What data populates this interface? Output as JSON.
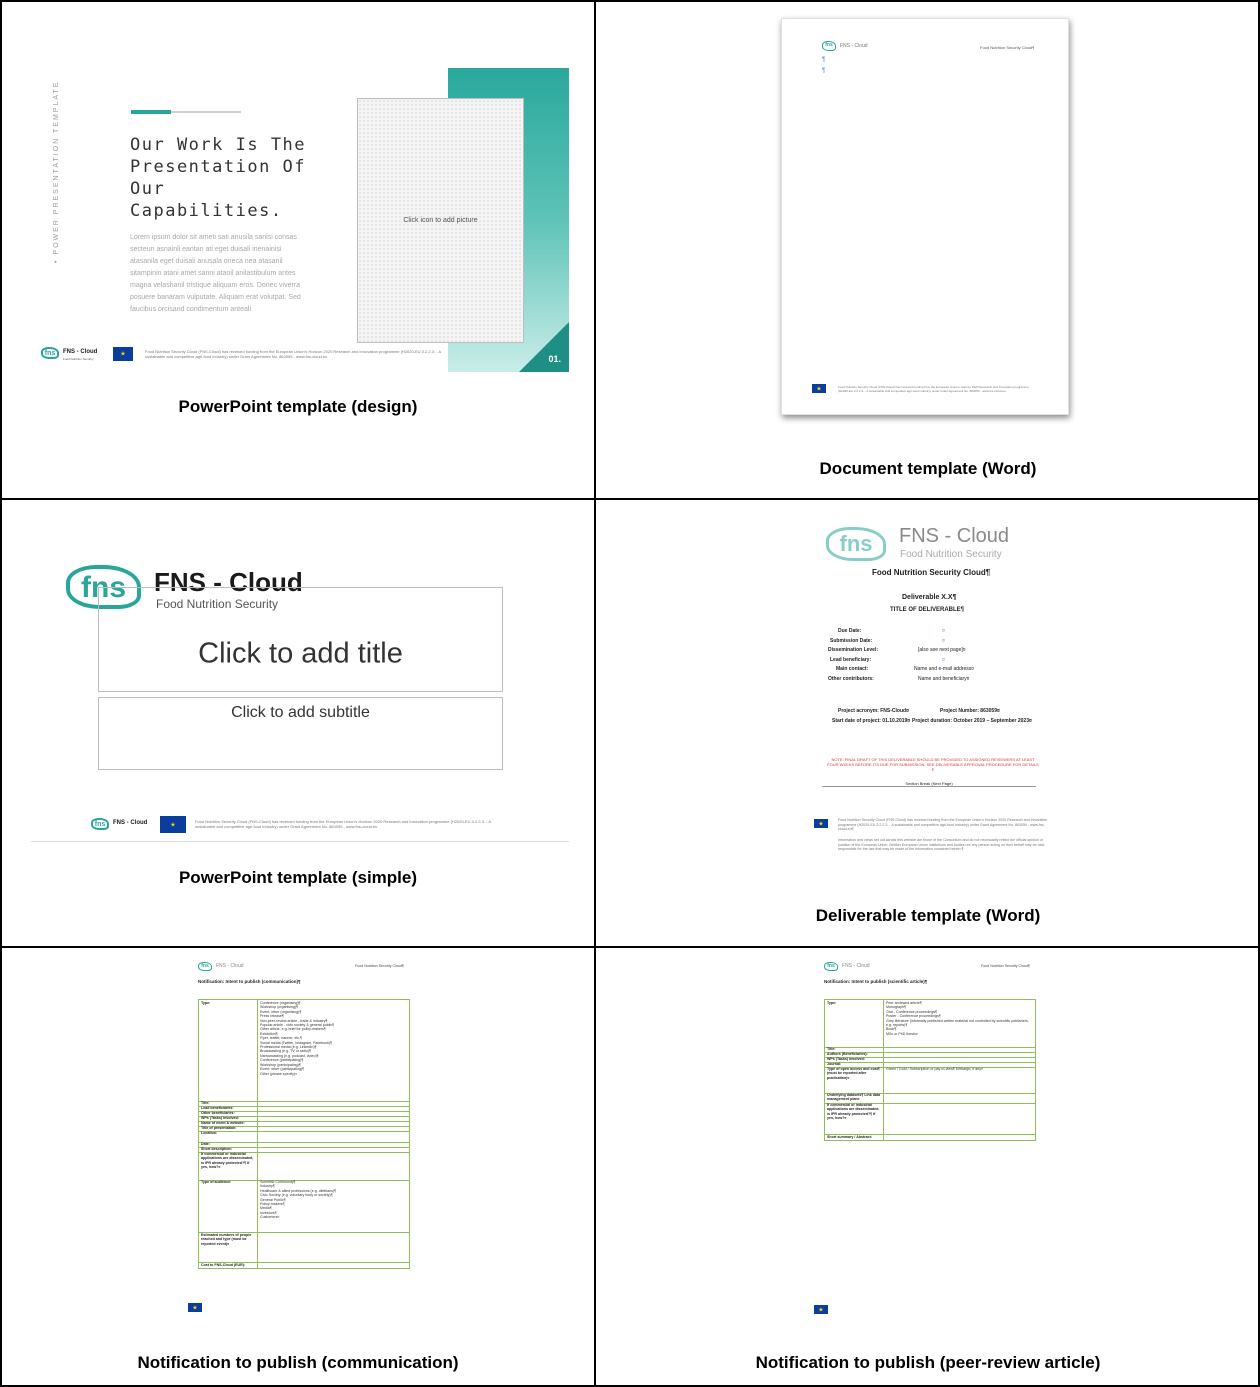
{
  "captions": {
    "ppt_design": "PowerPoint template (design)",
    "doc_word": "Document template (Word)",
    "ppt_simple": "PowerPoint template (simple)",
    "deliverable_word": "Deliverable template (Word)",
    "notif_comm": "Notification to publish (communication)",
    "notif_peer": "Notification to publish (peer-review article)"
  },
  "ppt_design": {
    "vertical_text": "• POWER PRESENTATION TEMPLATE",
    "heading_lines": [
      "Our Work Is The",
      "Presentation Of",
      "Our",
      "Capabilities."
    ],
    "body": "Lorem ipsum dolor sit ameti sati anusila sanisi consas secteun asnainli eantan ati eget duisali inenainisi atasanila eget duisali anusala oneca nea atasanil sitampinin atani amet sanni ataoil anilastibulum antes magna velashanil tristique aliquam eros. Donec viverra posuere banaram vulputate. Aliquam erat volutpat. Sed faucibus orcisand condimentum anteali",
    "picture_placeholder": "Click icon to add picture",
    "logo_name": "FNS - Cloud",
    "logo_tag": "Food Nutrition Security",
    "footer_text": "Food Nutrition Security Cloud (FNS-Cloud) has received funding from the European Union's Horizon 2020 Research and Innovation programme (H2020-EU.3.2.2.3. - A sustainable and competitive agri-food industry) under Grant Agreement No. 863059 - www.fns-cloud.eu",
    "slide_number": "01."
  },
  "doc_word": {
    "logo_name": "FNS - Cloud",
    "header_right": "Food Nutrition Security Cloud¶",
    "pilcrow": "¶",
    "footer_text": "Food Nutrition Security Cloud (FNS-Cloud) has received funding from the European Union's Horizon 2020 Research and Innovation programme (H2020-EU.3.2.2.3. - A sustainable and competitive agri-food industry) under Grant Agreement No. 863059 - www.fns-cloud.eu"
  },
  "ppt_simple": {
    "logo_name": "FNS - Cloud",
    "logo_tag": "Food Nutrition Security",
    "title_placeholder": "Click to add title",
    "subtitle_placeholder": "Click to add subtitle",
    "footer_text": "Food Nutrition Security Cloud (FNS-Cloud) has received funding from the European Union's Horizon 2020 Research and Innovation programme (H2020-EU.3.2.2.3. - A sustainable and competitive agri-food industry) under Grant Agreement No. 863059 - www.fns-cloud.eu"
  },
  "deliverable": {
    "logo_name": "FNS - Cloud",
    "logo_tag": "Food Nutrition Security",
    "org_name": "Food Nutrition Security Cloud¶",
    "deliverable": "Deliverable X.X¶",
    "title": "TITLE OF DELIVERABLE¶",
    "fields": [
      {
        "label": "Due Date:",
        "value": "¤"
      },
      {
        "label": "Submission Date:",
        "value": "¤"
      },
      {
        "label": "Dissemination Level:",
        "value": "[also see next page]¤"
      },
      {
        "label": "Lead beneficiary:",
        "value": "¤"
      },
      {
        "label": "Main contact:",
        "value": "Name and e-mail address¤"
      },
      {
        "label": "Other contributors:",
        "value": "Name and beneficiary¤"
      }
    ],
    "acronym": "Project acronym: FNS-Cloud¤",
    "project_number": "Project Number: 863059¤",
    "start_date": "Start date of project: 01.10.2019¤",
    "duration": "Project duration: October 2019 – September 2023¤",
    "note": "NOTE: FINAL DRAFT OF THIS DELIVERABLE SHOULD BE PROVIDED TO ASSIGNED REVIEWERS AT LEAST FOUR WEEKS BEFORE ITS DUE FOR SUBMISSION. SEE DELIVERABLE APPROVAL PROCEDURE FOR DETAILS ¶",
    "section_break": "Section Break (Next Page)",
    "footer1": "Food Nutrition Security Cloud (FNS-Cloud) has received funding from the European Union's Horizon 2020 Research and Innovation programme (H2020-EU.3.2.2.3. - A sustainable and competitive agri-food industry) under Grant Agreement No. 863059 - www.fns-cloud.eu¶",
    "footer2": "Information and views set out across this website are those of the Consortium and do not necessarily reflect the official opinion or position of the European Union. Neither European Union institutions and bodies nor any person acting on their behalf may be held responsible for the use that may be made of the information contained herein ¶"
  },
  "notif_comm": {
    "logo_name": "FNS - Cloud",
    "header_right": "Food Nutrition Security Cloud¶",
    "title": "Notification: Intent to publish (communication)¶",
    "type_label": "Type:",
    "type_values": [
      "Conference (organising)¶",
      "Workshop (organising)¶",
      "Event, other (organising)¶",
      "Press release¶",
      "Non-peer-review article - trade & industry¶",
      "Popular article - civic society & general public¶",
      "Other article, e.g. brief for policy-makers¶",
      "Exhibition¶",
      "Flyer, leaflet, banner, etc.¶",
      "Social media (Twitter, Instagram, Facebook)¶",
      "Professional media (e.g. LinkedIn)¶",
      "Broadcasting (e.g. TV or radio)¶",
      "Narrowcasting (e.g. podcast, video)¶",
      "Conference (participating)¶",
      "Workshop (participating)¶",
      "Event, other (participating)¶",
      "Other (please specify)¤"
    ],
    "rows": [
      "Title:",
      "Lead beneficiaries:",
      "Other beneficiaries:",
      "WPs (Tasks) involved:",
      "Name of event & website:",
      "Title of presentation:",
      "Location:",
      "Date:",
      "Short description:"
    ],
    "ipr_label": "If commercial or industrial applications are disseminated, is IPR already protected?¶ If yes, how?¤",
    "audience_label": "Type of audience:",
    "audience_values": [
      "Scientific Community¶",
      "Industry¶",
      "Healthcare & allied professions (e.g. dietitians)¶",
      "Civic Society (e.g. voluntary body or society)¶",
      "General Public¶",
      "Policy-makers¶",
      "Media¶",
      "Investors¶",
      "Customers¤"
    ],
    "estimated_label": "Estimated numbers of people reached and type (must be reported event)¤",
    "cost_label": "Cost to FNS-Cloud (EUR):"
  },
  "notif_peer": {
    "logo_name": "FNS - Cloud",
    "header_right": "Food Nutrition Security Cloud¶",
    "title": "Notification: Intent to publish (scientific article)¶",
    "type_label": "Type:",
    "type_values": [
      "Peer-reviewed article¶",
      "Monograph¶",
      "Oral - Conference proceedings¶",
      "Poster - Conference proceedings¶",
      "Grey literature (informally published written material not controlled by scientific publishers, e.g. reports)¶",
      "Book¶",
      "MSc or PhD thesis¤"
    ],
    "rows": [
      "Title:",
      "Authors (Beneficiaries):",
      "WPs (Tasks) involved:",
      "Journal:"
    ],
    "open_access_label": "Type of open access and cost¶ (must be reported after publication)¤",
    "open_access_value": "Green / Gold / Subscription or pay-to-view¶ Embargo, if any¤",
    "datasets_label": "Underlying datasets¶ Link data management plan¤",
    "ipr_label": "If commercial or industrial applications are disseminated, is IPR already protected?¶ If yes, how?¤",
    "summary_label": "Short summary / Abstract:"
  }
}
